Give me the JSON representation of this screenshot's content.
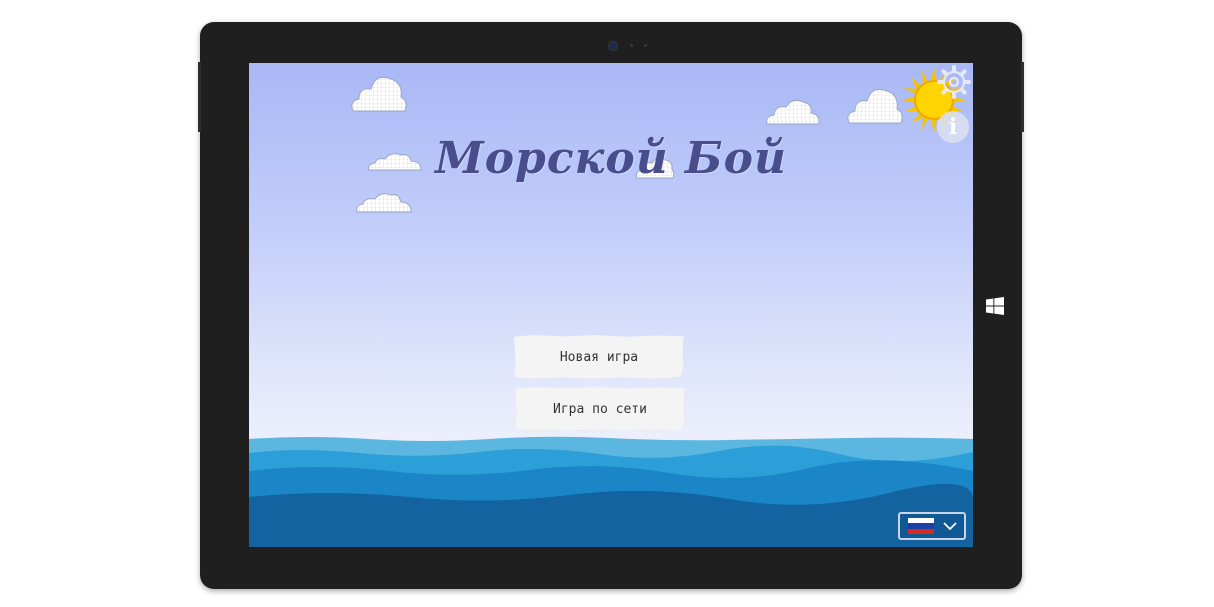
{
  "game": {
    "title": "Морской Бой",
    "menu": {
      "new_game": "Новая игра",
      "network_game": "Игра по сети"
    },
    "info_label": "i"
  },
  "colors": {
    "sky_top": "#a9b8f6",
    "sky_bottom": "#eef0fb",
    "title": "#4a4d8c",
    "sun": "#f5c400",
    "sea_light": "#4fb0dc",
    "sea_mid": "#1f8fd0",
    "sea_dark": "#0f5a9a"
  },
  "language": {
    "selected_flag": "russia-flag",
    "flag_colors": [
      "#ffffff",
      "#1c3fa8",
      "#d52b1e"
    ]
  },
  "icons": {
    "settings": "gear-icon",
    "info": "info-icon",
    "dropdown": "chevron-down-icon",
    "windows": "windows-logo-icon"
  }
}
